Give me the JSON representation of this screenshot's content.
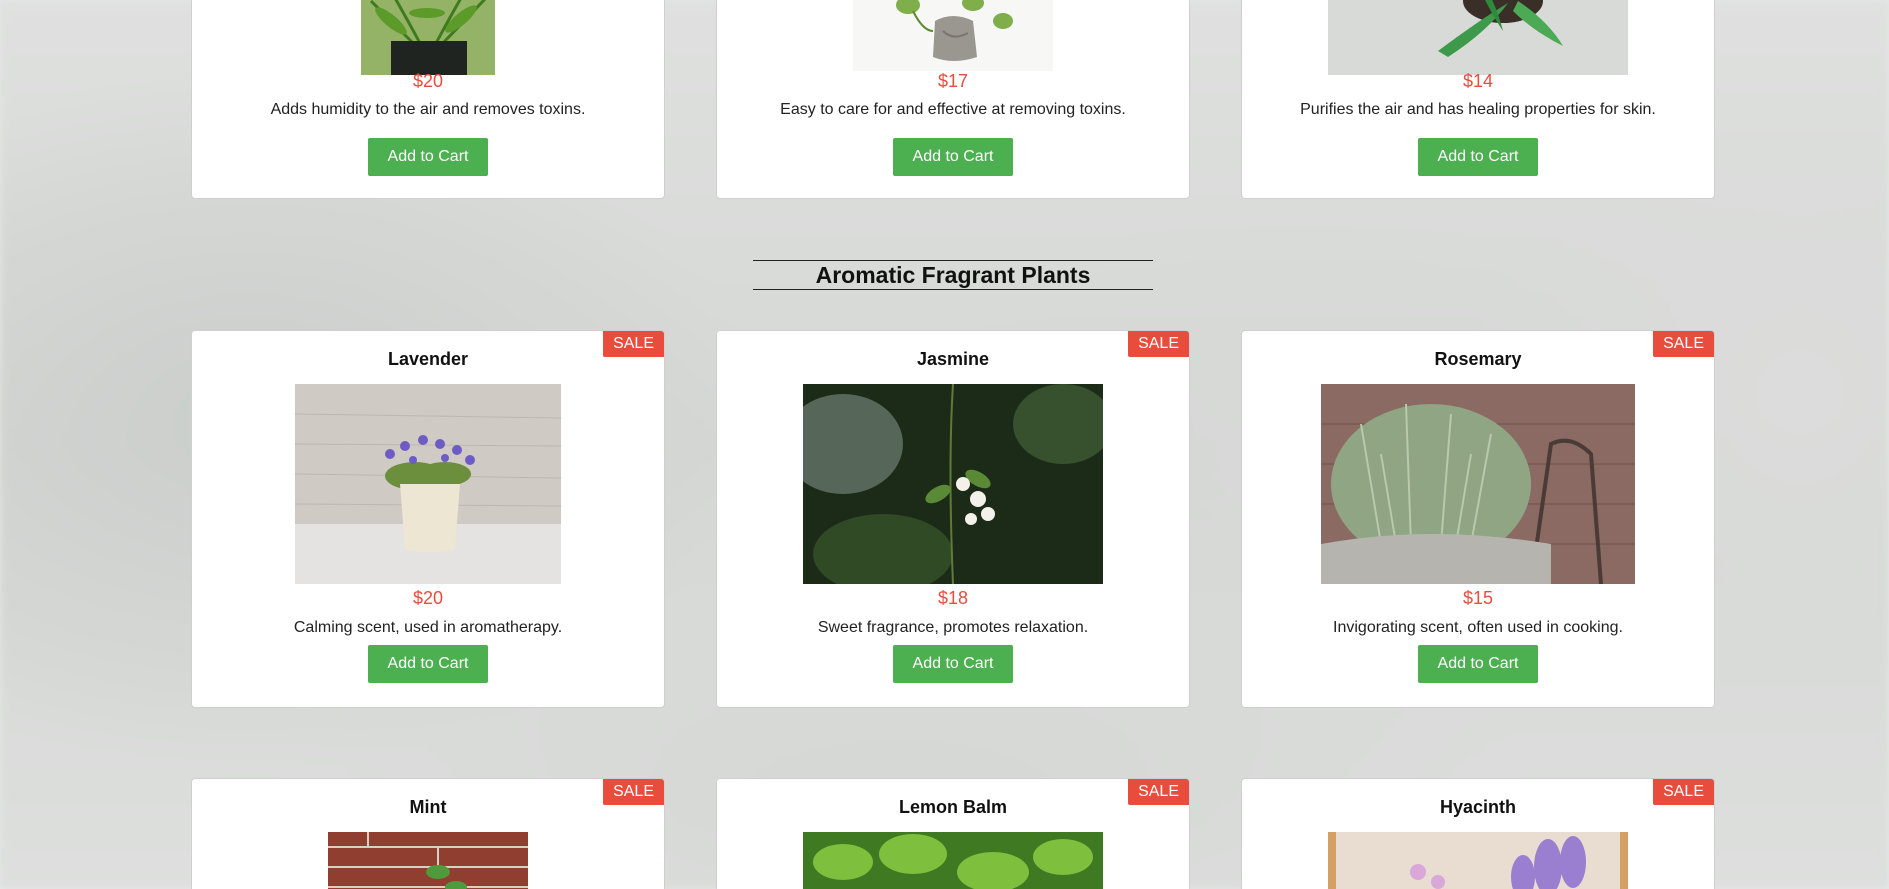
{
  "section_aromatic": {
    "title": "Aromatic Fragrant Plants"
  },
  "top_row": [
    {
      "price": "$20",
      "desc": "Adds humidity to the air and removes toxins.",
      "button": "Add to Cart",
      "image": "fern-in-pot"
    },
    {
      "price": "$17",
      "desc": "Easy to care for and effective at removing toxins.",
      "button": "Add to Cart",
      "image": "pothos-in-stone-pot"
    },
    {
      "price": "$14",
      "desc": "Purifies the air and has healing properties for skin.",
      "button": "Add to Cart",
      "image": "aloe-vera"
    }
  ],
  "aromatic_row": [
    {
      "badge": "SALE",
      "name": "Lavender",
      "price": "$20",
      "desc": "Calming scent, used in aromatherapy.",
      "button": "Add to Cart",
      "image": "lavender-in-basket"
    },
    {
      "badge": "SALE",
      "name": "Jasmine",
      "price": "$18",
      "desc": "Sweet fragrance, promotes relaxation.",
      "button": "Add to Cart",
      "image": "jasmine-flowers"
    },
    {
      "badge": "SALE",
      "name": "Rosemary",
      "price": "$15",
      "desc": "Invigorating scent, often used in cooking.",
      "button": "Add to Cart",
      "image": "rosemary-pot"
    }
  ],
  "bottom_row": [
    {
      "badge": "SALE",
      "name": "Mint",
      "image": "mint-brick-wall"
    },
    {
      "badge": "SALE",
      "name": "Lemon Balm",
      "image": "lemon-balm-leaves"
    },
    {
      "badge": "SALE",
      "name": "Hyacinth",
      "image": "hyacinth-purple"
    }
  ],
  "colors": {
    "price": "#e84c3d",
    "button": "#4caf50",
    "badge": "#e74c3c"
  }
}
